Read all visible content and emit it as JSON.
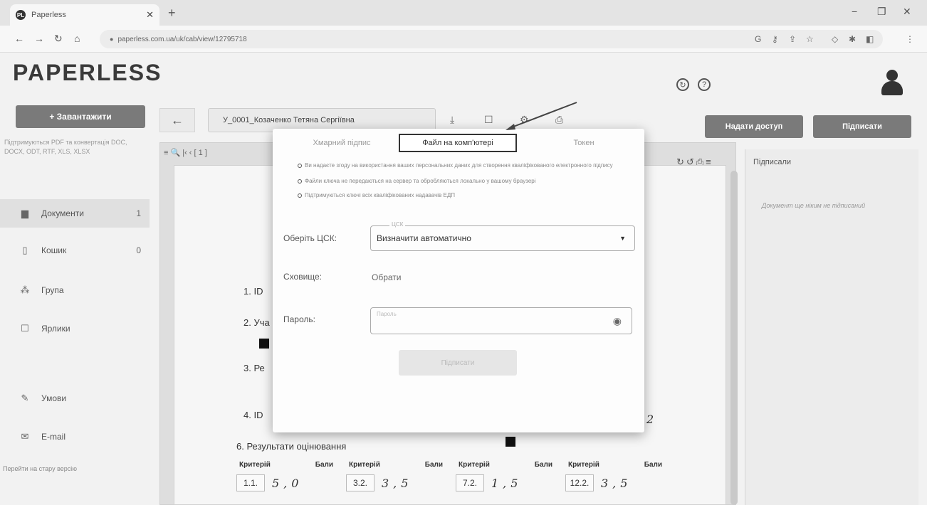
{
  "browser": {
    "tab_title": "Paperless",
    "favicon_text": "PL",
    "url": "paperless.com.ua/uk/cab/view/12795718"
  },
  "app": {
    "logo": "PAPERLESS"
  },
  "sidebar": {
    "upload_label": "+ Завантажити",
    "support_text": "Підтримуються PDF та конвертація DOC, DOCX, ODT, RTF, XLS, XLSX",
    "items": [
      {
        "label": "Документи",
        "count": "1"
      },
      {
        "label": "Кошик",
        "count": "0"
      },
      {
        "label": "Група",
        "count": ""
      },
      {
        "label": "Ярлики",
        "count": ""
      },
      {
        "label": "Умови",
        "count": ""
      },
      {
        "label": "E-mail",
        "count": ""
      }
    ],
    "old_version_link": "Перейти на стару версію"
  },
  "toolbar": {
    "doc_name": "У_0001_Козаченко Тетяна Сергіївна",
    "share_label": "Надати доступ",
    "sign_label": "Підписати"
  },
  "document": {
    "lines": [
      "1. ID",
      "2. Уча",
      "3. Ре",
      "4. ID",
      "6. Результати оцінювання"
    ],
    "digit": "2",
    "score_header_crit": "Критерій",
    "score_header_points": "Бали",
    "scores": [
      {
        "crit": "1.1.",
        "val": "5,0"
      },
      {
        "crit": "3.2.",
        "val": "3,5"
      },
      {
        "crit": "7.2.",
        "val": "1,5"
      },
      {
        "crit": "12.2.",
        "val": "3,5"
      }
    ]
  },
  "signers": {
    "title": "Підписали",
    "empty": "Документ ще ніким не підписаний"
  },
  "modal": {
    "tabs": [
      "Хмарний підпис",
      "Файл на комп'ютері",
      "Токен"
    ],
    "active_tab": 1,
    "info": [
      "Ви надаєте згоду на використання ваших персональних даних для створення кваліфікованого електронного підпису",
      "Файли ключа не передаються на сервер та обробляються локально у вашому браузері",
      "Підтримуються ключі всіх кваліфікованих надавачів ЕДП"
    ],
    "csk_label": "Оберіть ЦСК:",
    "csk_legend": "ЦСК",
    "csk_value": "Визначити автоматично",
    "storage_label": "Сховище:",
    "storage_value": "Обрати",
    "password_label": "Пароль:",
    "password_placeholder": "Пароль",
    "sign_button": "Підписати"
  }
}
